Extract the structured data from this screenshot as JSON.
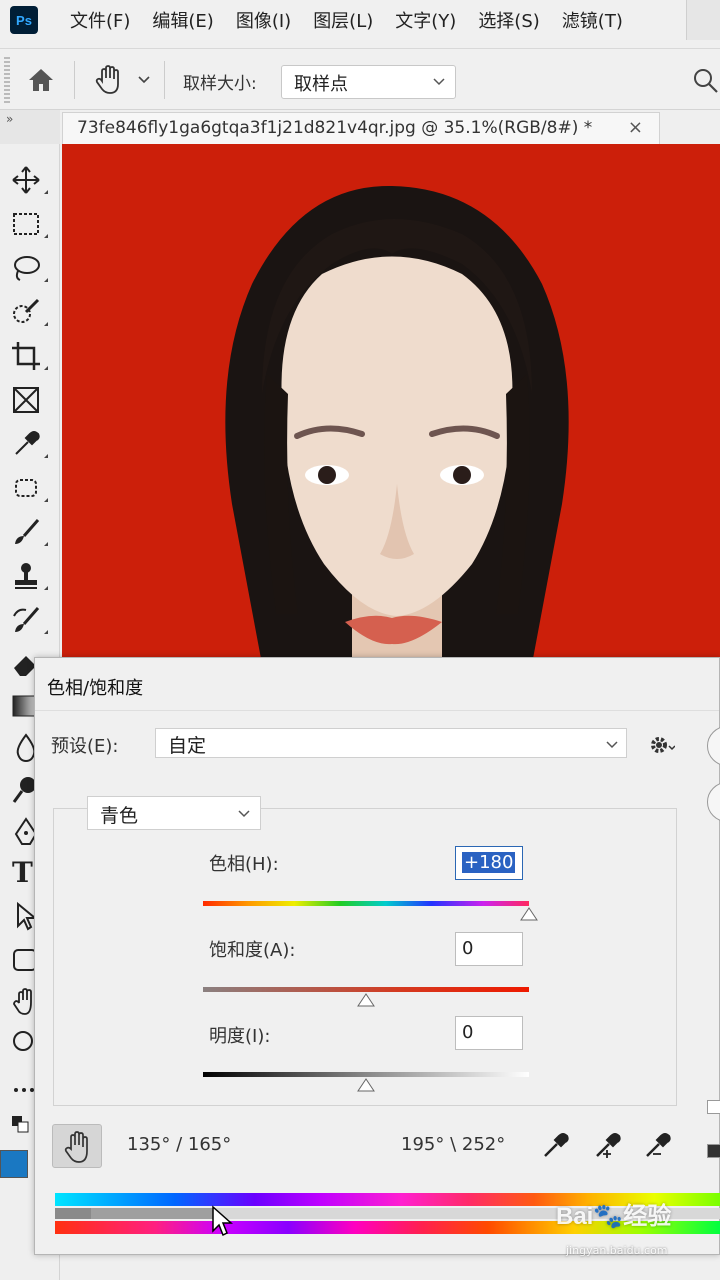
{
  "menubar": {
    "logo": "Ps",
    "items": [
      "文件(F)",
      "编辑(E)",
      "图像(I)",
      "图层(L)",
      "文字(Y)",
      "选择(S)",
      "滤镜(T)"
    ]
  },
  "options_bar": {
    "sample_size_label": "取样大小:",
    "sample_size_value": "取样点"
  },
  "document": {
    "tab_title": "73fe846fly1ga6gtqa3f1j21d821v4qr.jpg @ 35.1%(RGB/8#) *",
    "close_glyph": "×",
    "background_color": "#cc1f0a"
  },
  "toolbar": {
    "text_tool_glyph": "T",
    "foreground_color": "#1a78c2"
  },
  "dialog": {
    "title": "色相/饱和度",
    "preset_label": "预设(E):",
    "preset_value": "自定",
    "channel_value": "青色",
    "hue_label": "色相(H):",
    "hue_value": "+180",
    "saturation_label": "饱和度(A):",
    "saturation_value": "0",
    "lightness_label": "明度(I):",
    "lightness_value": "0",
    "range_left": "135° /  165°",
    "range_right": "195° \\  252°"
  },
  "watermark": {
    "text": "Bai🐾经验",
    "url": "jingyan.baidu.com"
  }
}
